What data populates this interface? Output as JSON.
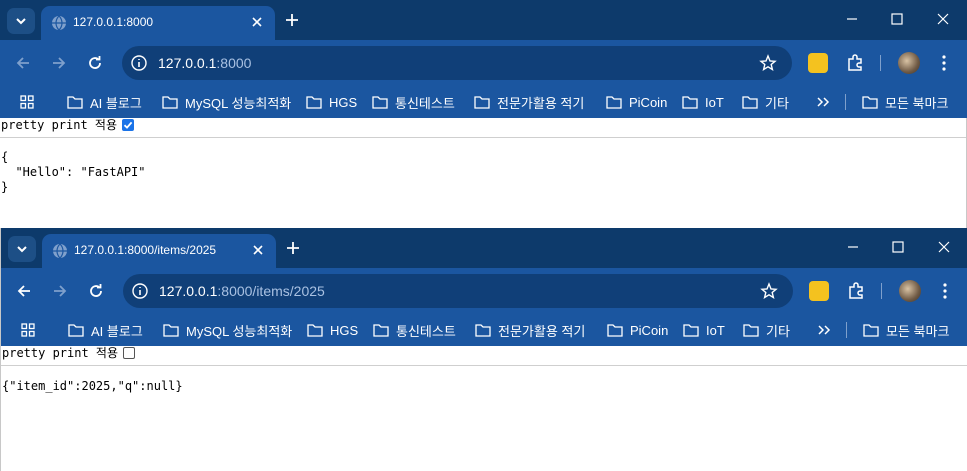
{
  "windows": [
    {
      "tab_title": "127.0.0.1:8000",
      "url_host": "127.0.0.1",
      "url_rest": ":8000",
      "pretty_print_label": "pretty print 적용",
      "pretty_print_checked": true,
      "json_lines": [
        "{",
        "  \"Hello\": \"FastAPI\"",
        "}"
      ]
    },
    {
      "tab_title": "127.0.0.1:8000/items/2025",
      "url_host": "127.0.0.1",
      "url_rest": ":8000/items/2025",
      "pretty_print_label": "pretty print 적용",
      "pretty_print_checked": false,
      "json_raw": "{\"item_id\":2025,\"q\":null}"
    }
  ],
  "bookmarks": [
    "AI 블로그",
    "MySQL 성능최적화",
    "HGS",
    "통신테스트",
    "전문가활용 적기",
    "PiCoin",
    "IoT",
    "기타"
  ],
  "all_bookmarks": "모든 북마크",
  "icons": {
    "tab_search": "chevron-down-icon",
    "favicon": "globe-icon",
    "close": "close-icon",
    "new_tab": "plus-icon",
    "back": "arrow-left-icon",
    "forward": "arrow-right-icon",
    "reload": "reload-icon",
    "info": "info-icon",
    "star": "star-icon",
    "extension_keep": "lightbulb-icon",
    "extension": "puzzle-icon",
    "menu": "kebab-icon",
    "apps": "apps-grid-icon",
    "folder": "folder-icon",
    "more": "chevron-double-right-icon"
  },
  "colors": {
    "tabstrip": "#0d3a6b",
    "toolbar": "#1b56a0",
    "omnibox": "#103f78",
    "checkbox_accent": "#1a73e8"
  }
}
